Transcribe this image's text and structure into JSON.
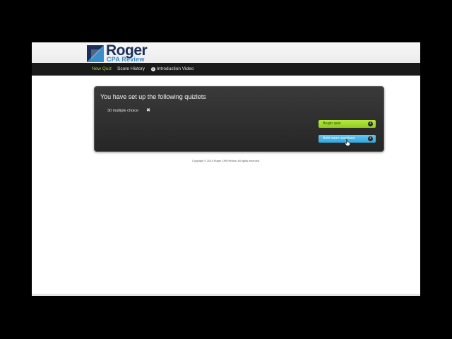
{
  "brand": {
    "name": "Roger",
    "subtitle": "CPA Review",
    "colors": {
      "navy": "#1c2f5a",
      "blue": "#3a8fc8",
      "green": "#9ad43b"
    }
  },
  "nav": {
    "items": [
      {
        "label": "New Quiz",
        "active": true
      },
      {
        "label": "Score History",
        "active": false
      },
      {
        "label": "Introduction Video",
        "active": false,
        "icon": "info-icon"
      }
    ]
  },
  "panel": {
    "title": "You have set up the following quizlets",
    "quizlets": [
      {
        "label": "30 multiple choice",
        "remove_icon": "close-icon"
      }
    ],
    "buttons": {
      "begin": {
        "label": "Begin quiz",
        "icon": "plus-circle-icon",
        "color": "#9ad43b"
      },
      "add": {
        "label": "Add more sections",
        "icon": "plus-circle-icon",
        "color": "#3fb3e6"
      }
    }
  },
  "footer": {
    "copyright": "Copyright © 2014 Roger CPA Review. All rights reserved."
  }
}
